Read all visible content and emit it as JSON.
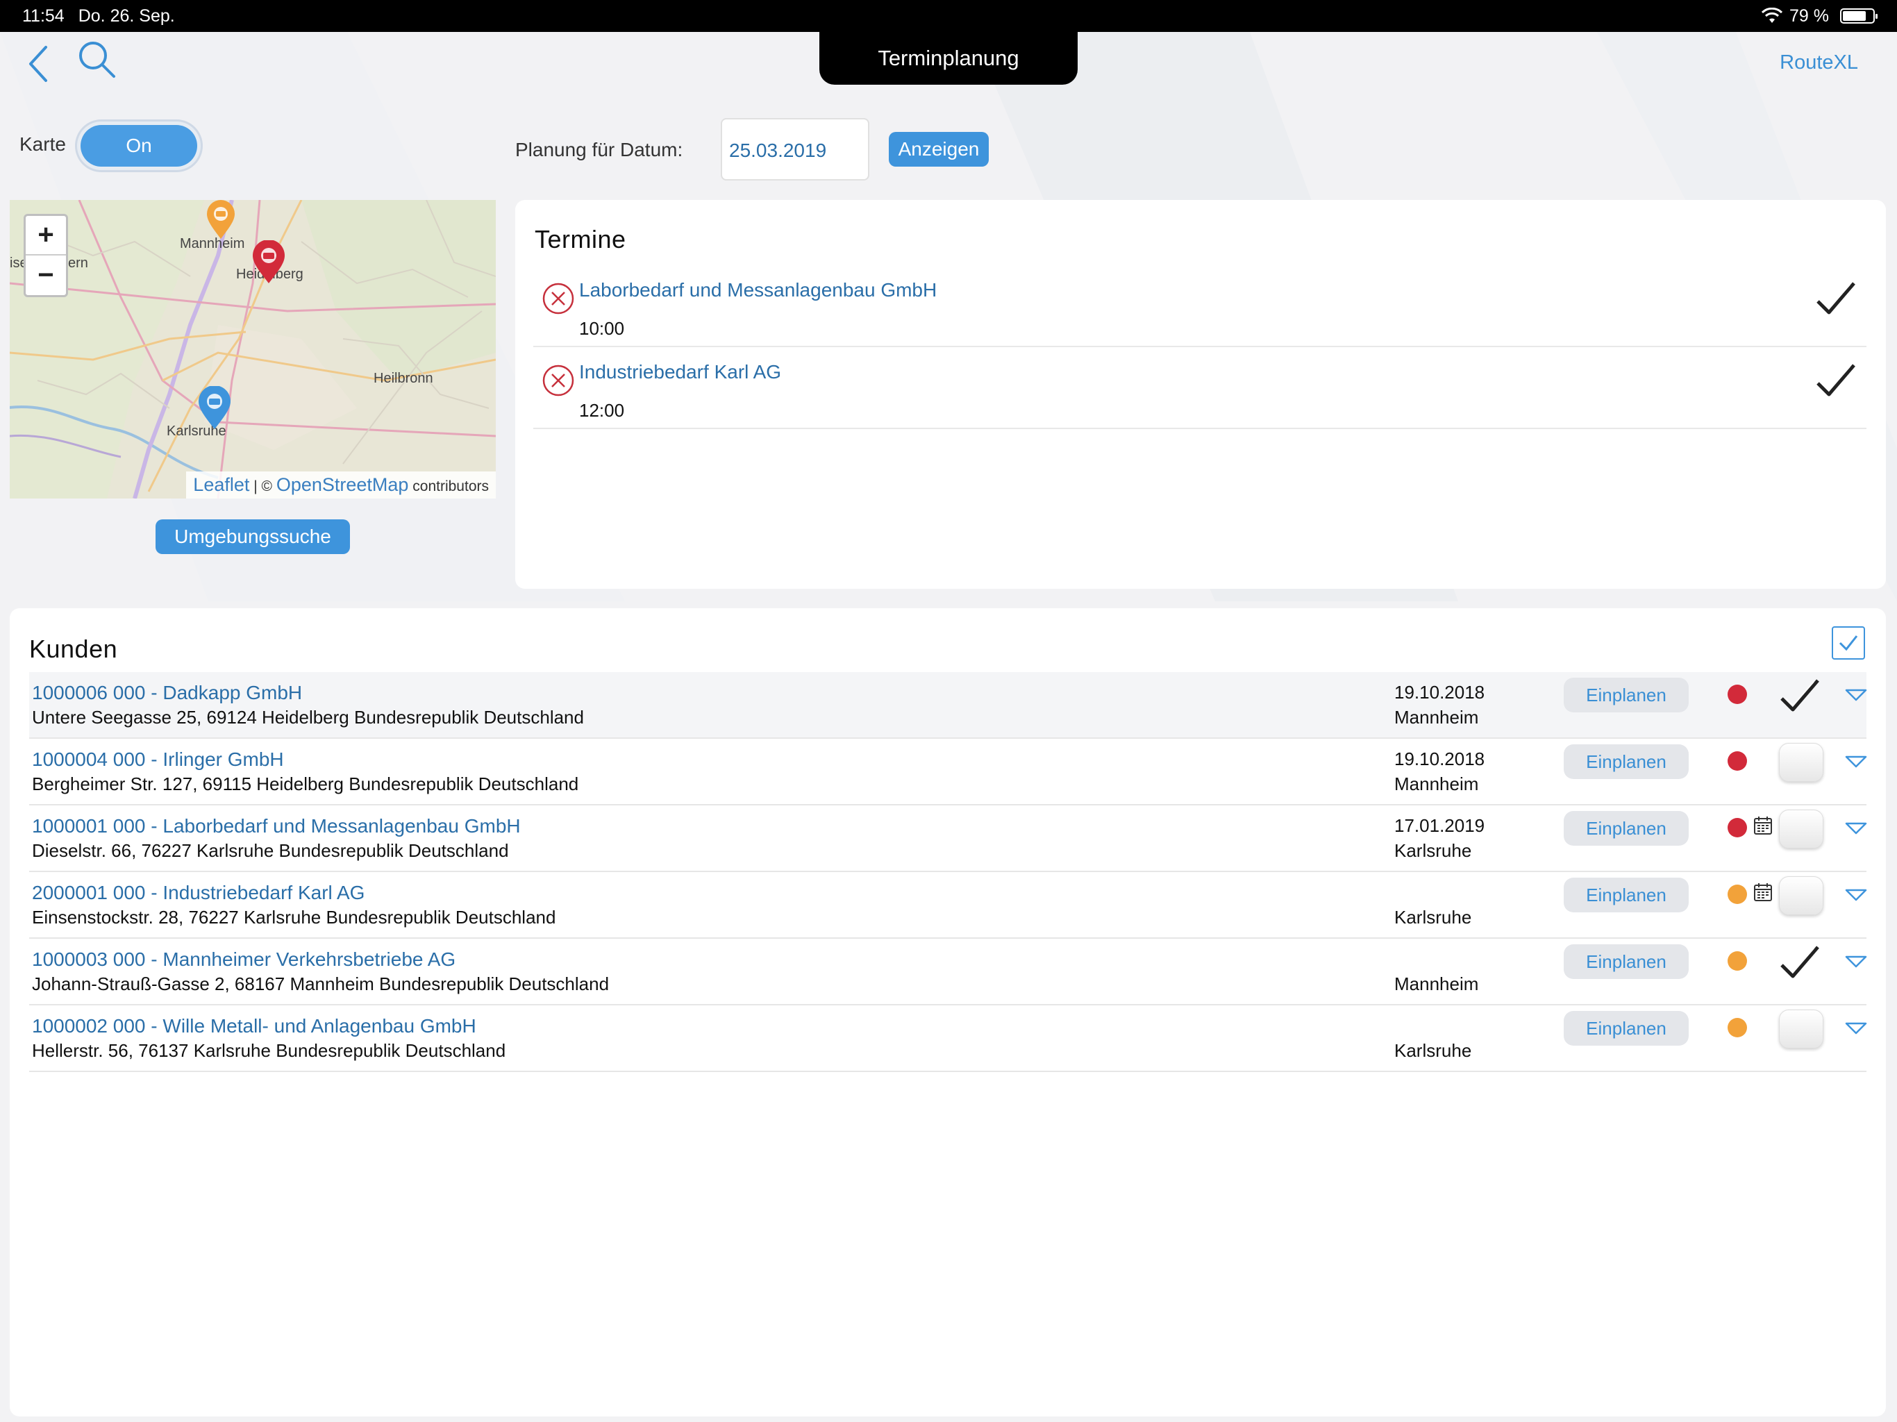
{
  "status": {
    "time": "11:54",
    "date": "Do. 26. Sep.",
    "battery": "79 %",
    "battery_level": 0.79
  },
  "header": {
    "title": "Terminplanung",
    "route_link": "RouteXL"
  },
  "karte": {
    "label": "Karte",
    "toggle_value": "On"
  },
  "planung": {
    "label": "Planung für Datum:",
    "date_value": "25.03.2019",
    "button_label": "Anzeigen"
  },
  "map": {
    "zoom_in": "+",
    "zoom_out": "−",
    "places": [
      "Mannheim",
      "Heidelberg",
      "Heilbronn",
      "Karlsruhe"
    ],
    "edge_labels": [
      "ise",
      "ern"
    ],
    "attribution": {
      "leaflet": "Leaflet",
      "sep": "| ©",
      "osm": "OpenStreetMap",
      "suffix": "contributors"
    },
    "marker_colors": {
      "orange": "#f2a23a",
      "red": "#d22a3a",
      "blue": "#3e94dc"
    },
    "search_button": "Umgebungssuche"
  },
  "termine": {
    "title": "Termine",
    "items": [
      {
        "name": "Laborbedarf und Messanlagenbau GmbH",
        "time": "10:00"
      },
      {
        "name": "Industriebedarf Karl AG",
        "time": "12:00"
      }
    ]
  },
  "kunden": {
    "title": "Kunden",
    "plan_label": "Einplanen",
    "rows": [
      {
        "name": "1000006 000 - Dadkapp GmbH",
        "address": "Untere Seegasse 25, 69124 Heidelberg Bundesrepublik Deutschland",
        "date": "19.10.2018",
        "city": "Mannheim",
        "dot_color": "#d22a3a",
        "calendar": false,
        "checked": true
      },
      {
        "name": "1000004 000 - Irlinger GmbH",
        "address": "Bergheimer Str. 127, 69115 Heidelberg Bundesrepublik Deutschland",
        "date": "19.10.2018",
        "city": "Mannheim",
        "dot_color": "#d22a3a",
        "calendar": false,
        "checked": false
      },
      {
        "name": "1000001 000 - Laborbedarf und Messanlagenbau GmbH",
        "address": "Dieselstr. 66, 76227 Karlsruhe Bundesrepublik Deutschland",
        "date": "17.01.2019",
        "city": "Karlsruhe",
        "dot_color": "#d22a3a",
        "calendar": true,
        "checked": false
      },
      {
        "name": "2000001 000 - Industriebedarf Karl AG",
        "address": "Einsenstockstr. 28, 76227 Karlsruhe Bundesrepublik Deutschland",
        "date": "",
        "city": "Karlsruhe",
        "dot_color": "#f2a23a",
        "calendar": true,
        "checked": false
      },
      {
        "name": "1000003 000 - Mannheimer Verkehrsbetriebe AG",
        "address": "Johann-Strauß-Gasse 2, 68167 Mannheim Bundesrepublik Deutschland",
        "date": "",
        "city": "Mannheim",
        "dot_color": "#f2a23a",
        "calendar": false,
        "checked": true
      },
      {
        "name": "1000002 000 - Wille Metall- und Anlagenbau GmbH",
        "address": "Hellerstr. 56, 76137 Karlsruhe Bundesrepublik Deutschland",
        "date": "",
        "city": "Karlsruhe",
        "dot_color": "#f2a23a",
        "calendar": false,
        "checked": false
      }
    ]
  }
}
